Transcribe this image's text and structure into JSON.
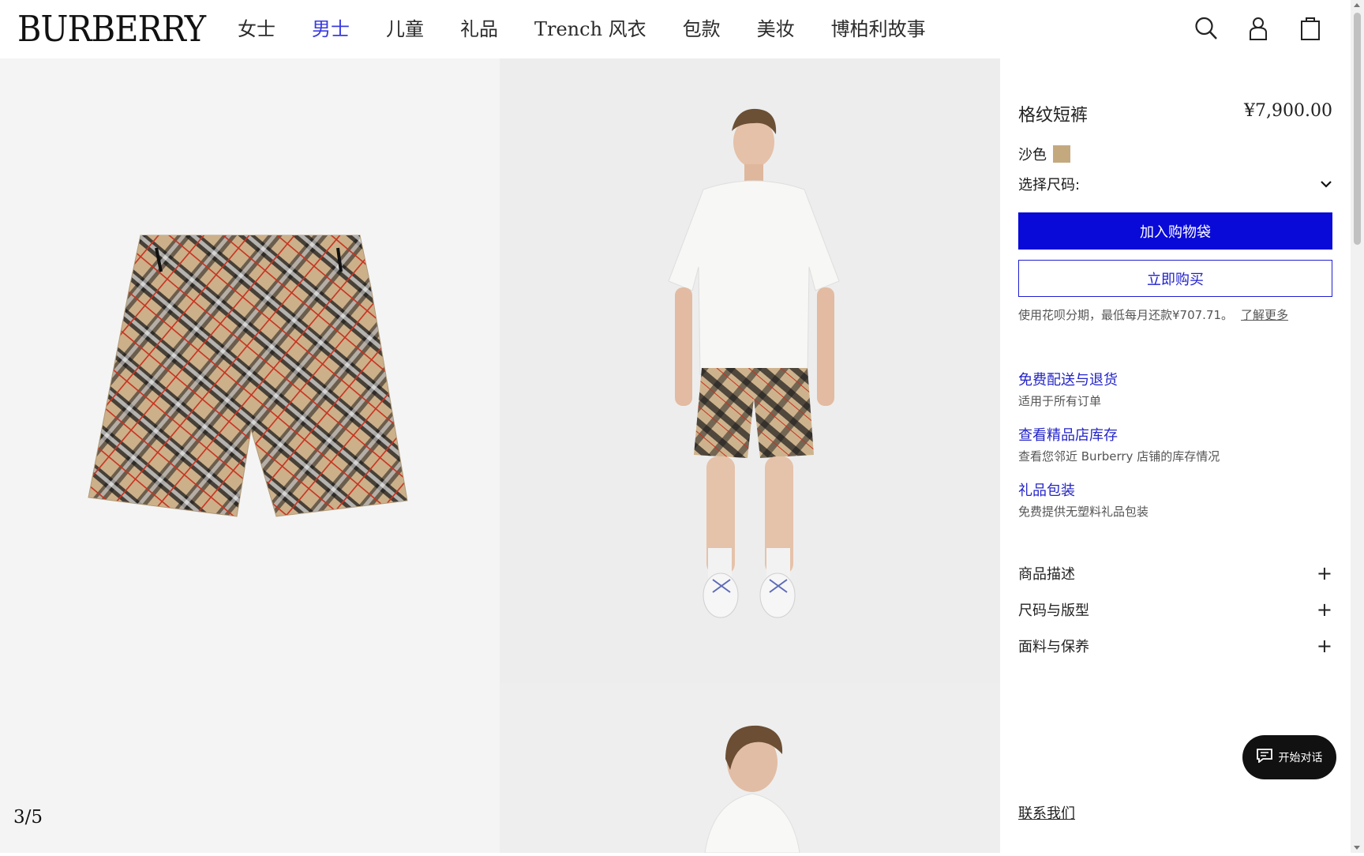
{
  "brand": {
    "logo": "BURBERRY"
  },
  "nav": {
    "items": [
      "女士",
      "男士",
      "儿童",
      "礼品",
      "Trench 风衣",
      "包款",
      "美妆",
      "博柏利故事"
    ],
    "active_index": 1
  },
  "header_icons": [
    "search-icon",
    "account-icon",
    "shopping-bag-icon"
  ],
  "gallery": {
    "counter": "3/5"
  },
  "product": {
    "title": "格纹短裤",
    "price": "¥7,900.00",
    "color_label": "沙色",
    "color_swatch": "#c4a97f",
    "size_label": "选择尺码:",
    "add_to_bag": "加入购物袋",
    "buy_now": "立即购买",
    "installment_text": "使用花呗分期，最低每月还款¥707.71。",
    "installment_link": "了解更多"
  },
  "services": [
    {
      "title": "免费配送与退货",
      "subtitle": "适用于所有订单"
    },
    {
      "title": "查看精品店库存",
      "subtitle": "查看您邻近 Burberry 店铺的库存情况"
    },
    {
      "title": "礼品包装",
      "subtitle": "免费提供无塑料礼品包装"
    }
  ],
  "accordion": [
    "商品描述",
    "尺码与版型",
    "面料与保养"
  ],
  "contact": "联系我们",
  "chat": {
    "label": "开始对话"
  },
  "colors": {
    "primary_blue": "#0a0ad8",
    "link_blue": "#2424c8",
    "active_nav": "#3a3ae0"
  }
}
